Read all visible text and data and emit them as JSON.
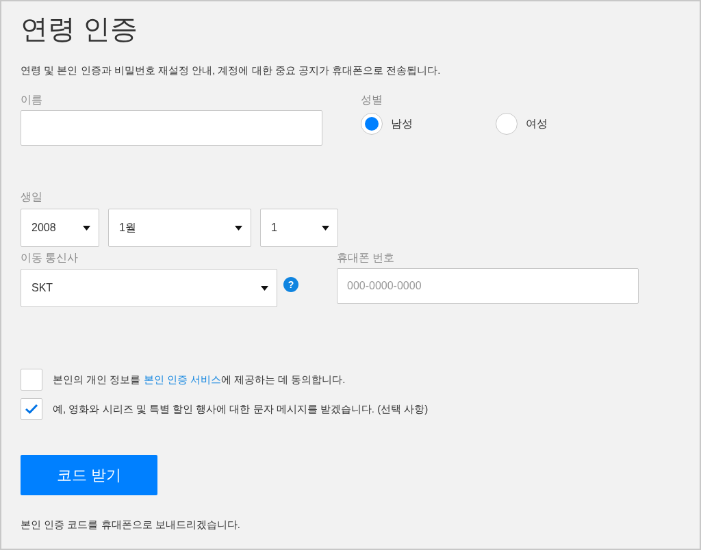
{
  "title": "연령 인증",
  "description": "연령 및 본인 인증과 비밀번호 재설정 안내, 계정에 대한 중요 공지가 휴대폰으로 전송됩니다.",
  "name_field": {
    "label": "이름"
  },
  "gender": {
    "label": "성별",
    "options": [
      {
        "label": "남성",
        "selected": true
      },
      {
        "label": "여성",
        "selected": false
      }
    ]
  },
  "birthday": {
    "label": "생일",
    "selects": [
      {
        "value": "2008"
      },
      {
        "value": "1월"
      },
      {
        "value": "1"
      }
    ]
  },
  "carrier": {
    "label": "이동 통신사",
    "value": "SKT",
    "help": "?"
  },
  "phone": {
    "label": "휴대폰 번호",
    "placeholder": "000-0000-0000"
  },
  "consents": [
    {
      "checked": false,
      "parts": [
        {
          "kind": "text",
          "text": "본인의 개인 정보를 "
        },
        {
          "kind": "link",
          "text": "본인 인증 서비스"
        },
        {
          "kind": "text",
          "text": "에 제공하는 데 동의합니다."
        }
      ]
    },
    {
      "checked": true,
      "parts": [
        {
          "kind": "text",
          "text": "예, 영화와 시리즈 및 특별 할인 행사에 대한 문자 메시지를 받겠습니다. (선택 사항)"
        }
      ]
    }
  ],
  "submit_button": "코드 받기",
  "footer_note": "본인 인증 코드를 휴대폰으로 보내드리겠습니다."
}
